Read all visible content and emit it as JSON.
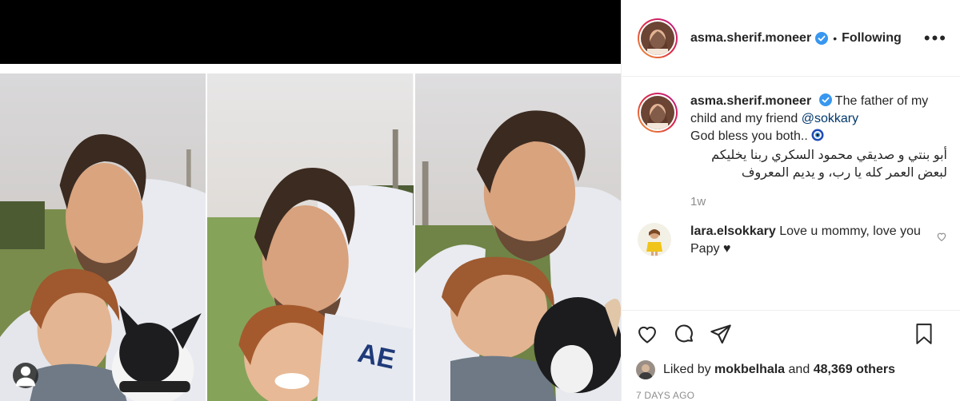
{
  "post": {
    "author": "asma.sherif.moneer",
    "follow_status": "Following",
    "separator": "•",
    "more_label": "•••"
  },
  "caption": {
    "author": "asma.sherif.moneer",
    "text_before_mention": "The father of my child and my friend",
    "mention": "@sokkary",
    "text_after": "God bless you both..",
    "text_arabic": "أبو بنتي و صديقي محمود السكري ربنا يخليكم لبعض العمر كله يا رب، و يديم المعروف",
    "time": "1w"
  },
  "comments": [
    {
      "author": "lara.elsokkary",
      "text": "Love u mommy, love you Papy ♥"
    }
  ],
  "likes": {
    "prefix": "Liked by",
    "user": "mokbelhala",
    "conjunction": "and",
    "count": "48,369 others"
  },
  "date": "7 DAYS AGO",
  "colors": {
    "text": "#262626",
    "secondary": "#8e8e8e",
    "verified": "#3897f0",
    "mention": "#00376b",
    "topbar": "#000000"
  },
  "icons": [
    "user-tag-icon",
    "verified-badge-icon",
    "more-options-icon",
    "heart-icon",
    "comment-icon",
    "share-icon",
    "bookmark-icon",
    "evil-eye-emoji"
  ]
}
